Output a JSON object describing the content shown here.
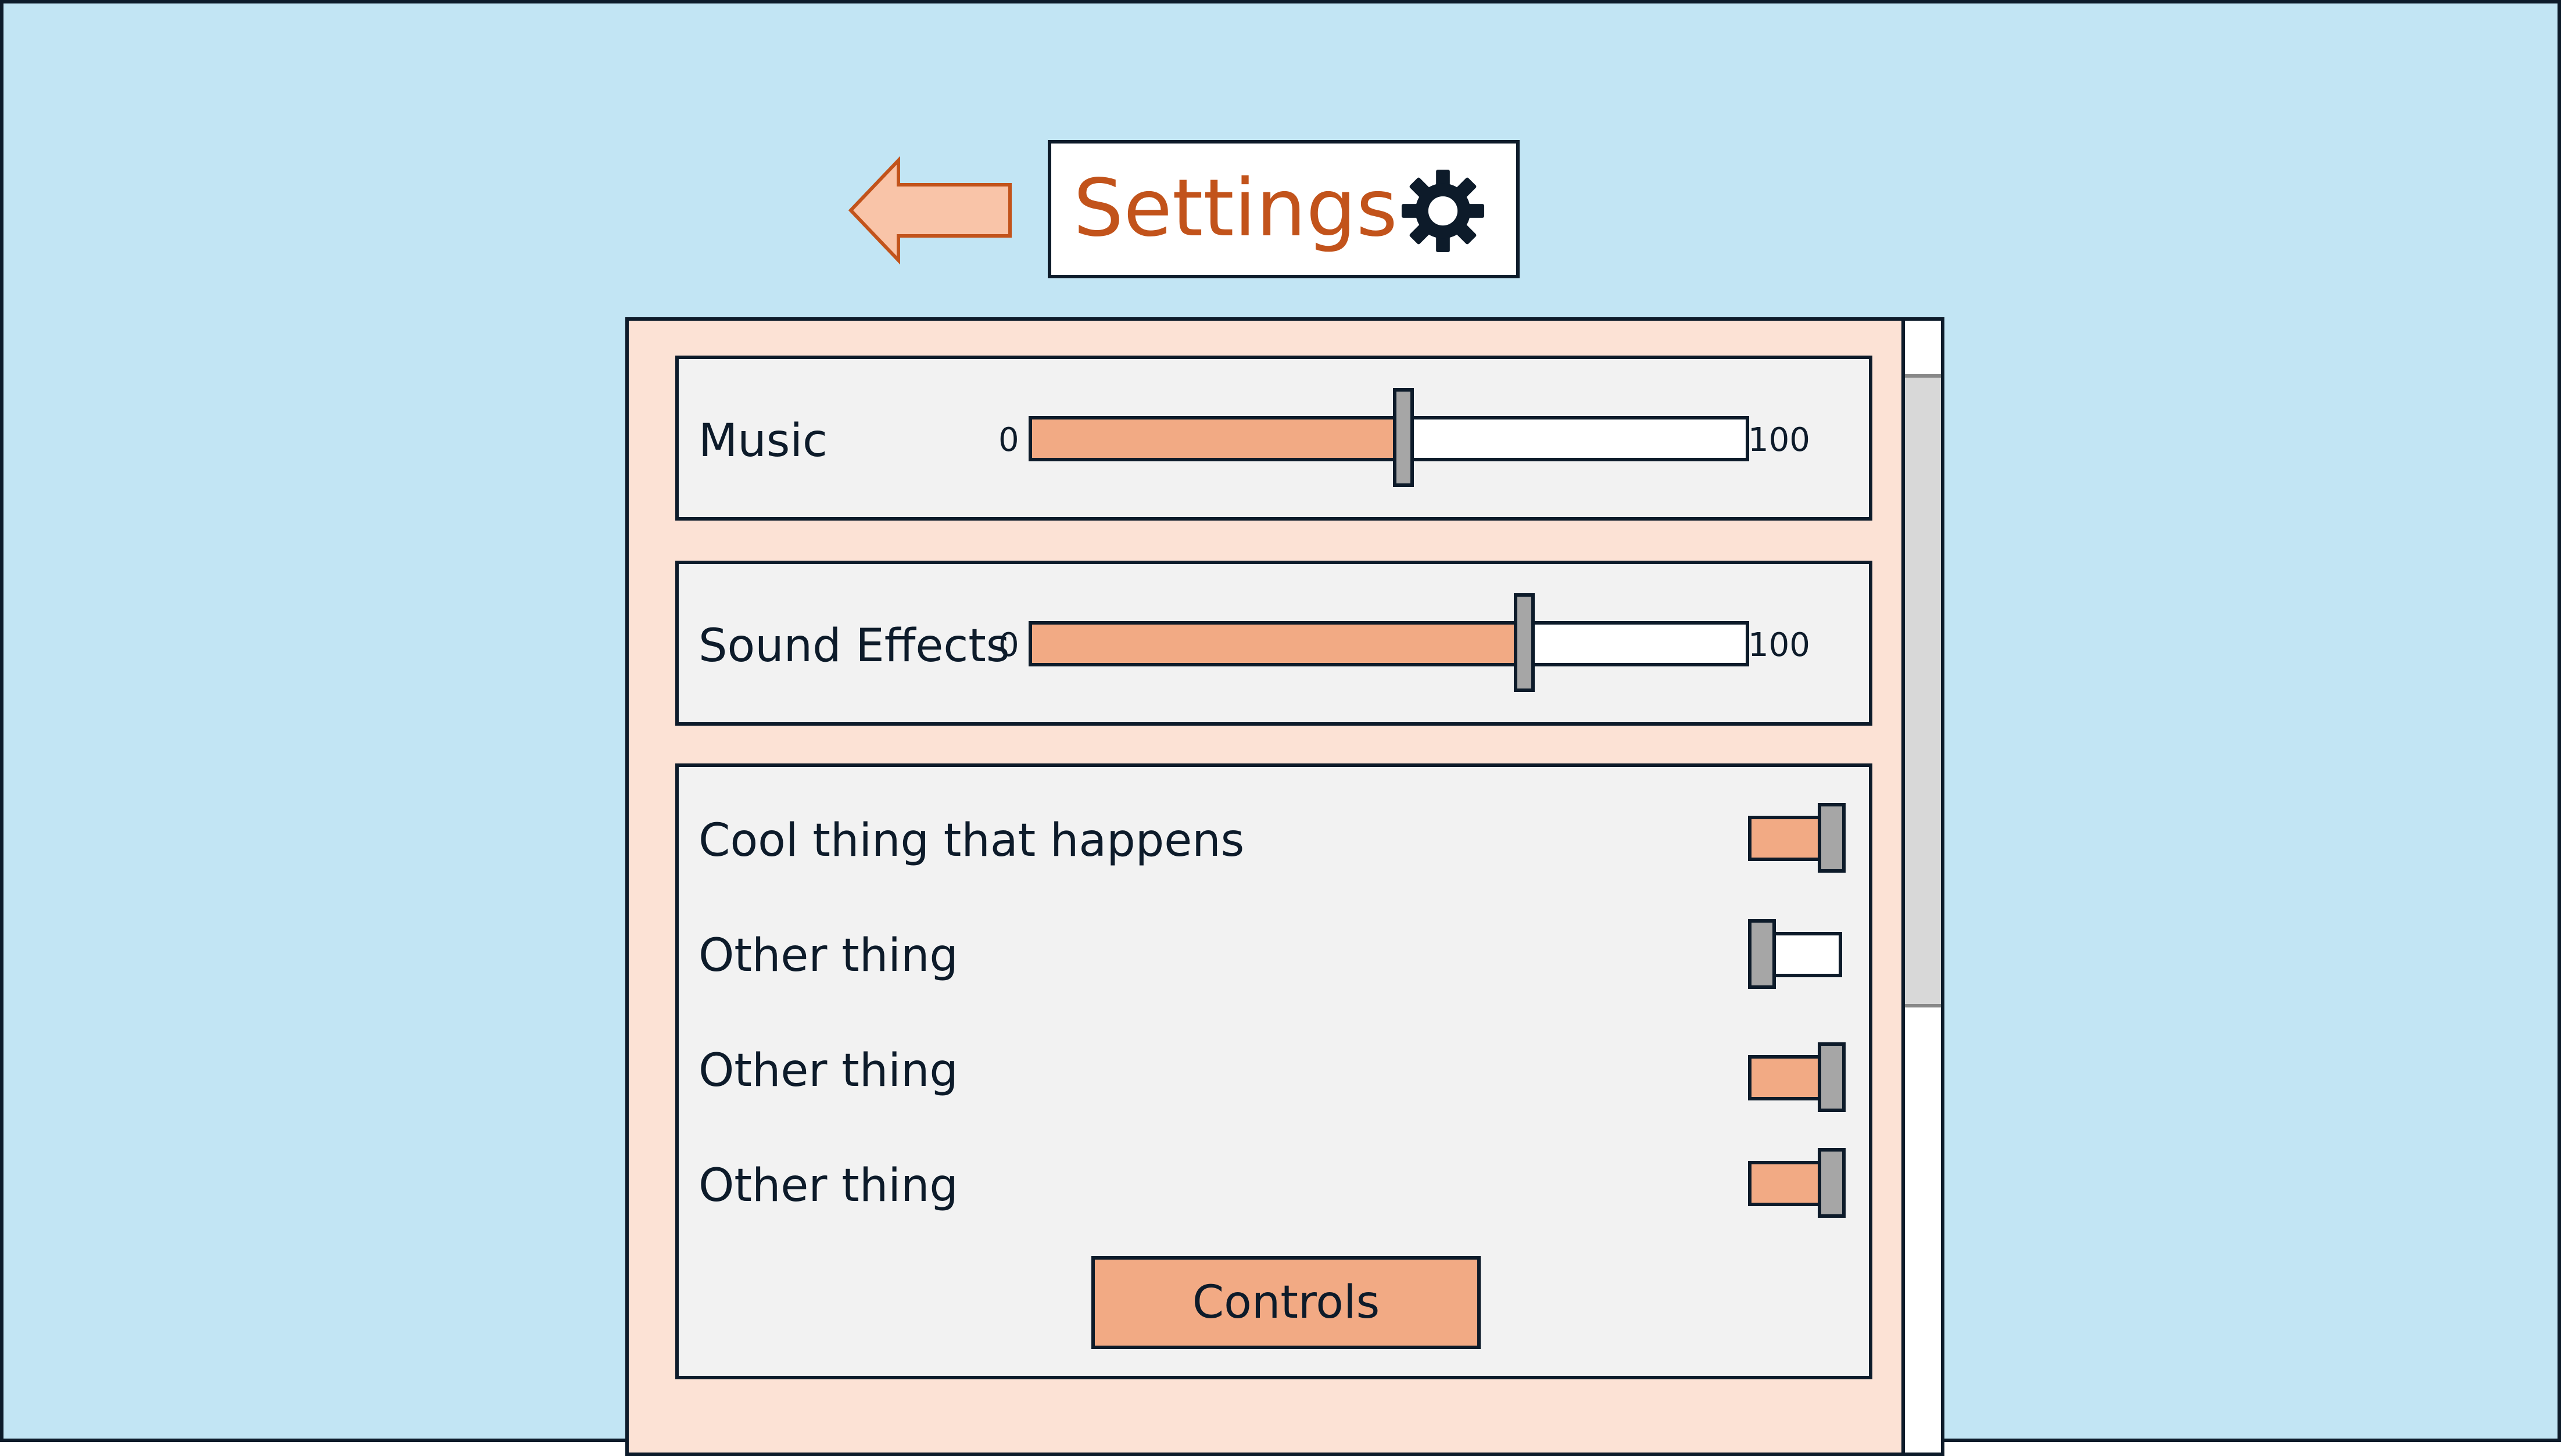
{
  "header": {
    "title": "Settings",
    "back_icon": "left-arrow-icon",
    "settings_icon": "gear-icon"
  },
  "colors": {
    "background": "#c2e5f4",
    "panel": "#fce2d5",
    "card": "#f2f2f2",
    "accent": "#f2aa84",
    "title": "#c2531b",
    "knob": "#a6a6a6",
    "outline": "#0d1b2a"
  },
  "settings": {
    "sliders": [
      {
        "label": "Music",
        "min": "0",
        "max": "100",
        "value": 52
      },
      {
        "label": "Sound Effects",
        "min": "0",
        "max": "100",
        "value": 69
      }
    ],
    "toggles": [
      {
        "label": "Cool thing that happens",
        "on": true
      },
      {
        "label": "Other thing",
        "on": false
      },
      {
        "label": "Other thing",
        "on": true
      },
      {
        "label": "Other thing",
        "on": true
      }
    ],
    "controls_label": "Controls"
  }
}
